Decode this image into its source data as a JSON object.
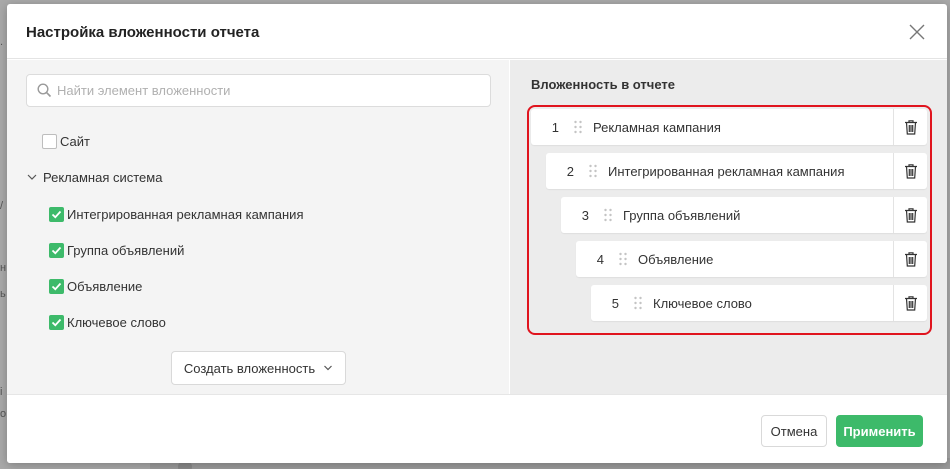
{
  "modal": {
    "title": "Настройка вложенности отчета",
    "close_icon": "close-icon"
  },
  "search": {
    "placeholder": "Найти элемент вложенности",
    "value": "",
    "icon": "search-icon"
  },
  "tree": {
    "site": {
      "label": "Сайт",
      "checked": false
    },
    "group": {
      "label": "Рекламная система",
      "expanded": true
    },
    "children": [
      {
        "label": "Интегрированная рекламная кампания",
        "checked": true
      },
      {
        "label": "Группа объявлений",
        "checked": true
      },
      {
        "label": "Объявление",
        "checked": true
      },
      {
        "label": "Ключевое слово",
        "checked": true
      }
    ]
  },
  "create_button": {
    "label": "Создать вложенность"
  },
  "nesting": {
    "title": "Вложенность в отчете",
    "items": [
      {
        "num": "1",
        "label": "Рекламная кампания"
      },
      {
        "num": "2",
        "label": "Интегрированная рекламная кампания"
      },
      {
        "num": "3",
        "label": "Группа объявлений"
      },
      {
        "num": "4",
        "label": "Объявление"
      },
      {
        "num": "5",
        "label": "Ключевое слово"
      }
    ]
  },
  "footer": {
    "cancel_label": "Отмена",
    "apply_label": "Применить"
  },
  "colors": {
    "accent_green": "#3dba6a",
    "highlight_red": "#e0141e"
  }
}
